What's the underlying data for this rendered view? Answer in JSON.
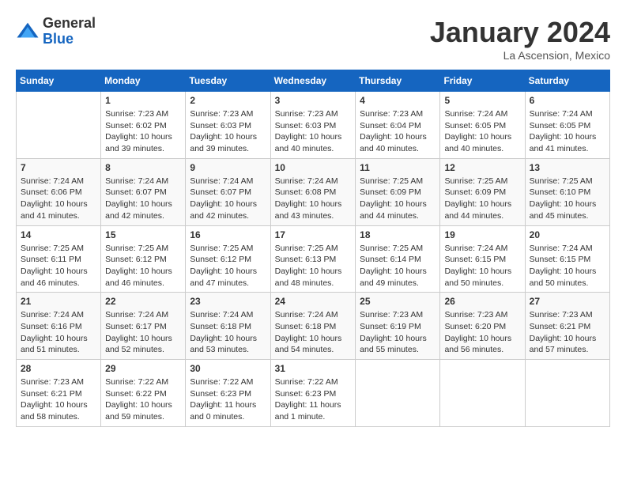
{
  "header": {
    "logo": {
      "general": "General",
      "blue": "Blue"
    },
    "title": "January 2024",
    "location": "La Ascension, Mexico"
  },
  "calendar": {
    "weekdays": [
      "Sunday",
      "Monday",
      "Tuesday",
      "Wednesday",
      "Thursday",
      "Friday",
      "Saturday"
    ],
    "weeks": [
      [
        {
          "day": "",
          "info": ""
        },
        {
          "day": "1",
          "info": "Sunrise: 7:23 AM\nSunset: 6:02 PM\nDaylight: 10 hours\nand 39 minutes."
        },
        {
          "day": "2",
          "info": "Sunrise: 7:23 AM\nSunset: 6:03 PM\nDaylight: 10 hours\nand 39 minutes."
        },
        {
          "day": "3",
          "info": "Sunrise: 7:23 AM\nSunset: 6:03 PM\nDaylight: 10 hours\nand 40 minutes."
        },
        {
          "day": "4",
          "info": "Sunrise: 7:23 AM\nSunset: 6:04 PM\nDaylight: 10 hours\nand 40 minutes."
        },
        {
          "day": "5",
          "info": "Sunrise: 7:24 AM\nSunset: 6:05 PM\nDaylight: 10 hours\nand 40 minutes."
        },
        {
          "day": "6",
          "info": "Sunrise: 7:24 AM\nSunset: 6:05 PM\nDaylight: 10 hours\nand 41 minutes."
        }
      ],
      [
        {
          "day": "7",
          "info": "Sunrise: 7:24 AM\nSunset: 6:06 PM\nDaylight: 10 hours\nand 41 minutes."
        },
        {
          "day": "8",
          "info": "Sunrise: 7:24 AM\nSunset: 6:07 PM\nDaylight: 10 hours\nand 42 minutes."
        },
        {
          "day": "9",
          "info": "Sunrise: 7:24 AM\nSunset: 6:07 PM\nDaylight: 10 hours\nand 42 minutes."
        },
        {
          "day": "10",
          "info": "Sunrise: 7:24 AM\nSunset: 6:08 PM\nDaylight: 10 hours\nand 43 minutes."
        },
        {
          "day": "11",
          "info": "Sunrise: 7:25 AM\nSunset: 6:09 PM\nDaylight: 10 hours\nand 44 minutes."
        },
        {
          "day": "12",
          "info": "Sunrise: 7:25 AM\nSunset: 6:09 PM\nDaylight: 10 hours\nand 44 minutes."
        },
        {
          "day": "13",
          "info": "Sunrise: 7:25 AM\nSunset: 6:10 PM\nDaylight: 10 hours\nand 45 minutes."
        }
      ],
      [
        {
          "day": "14",
          "info": "Sunrise: 7:25 AM\nSunset: 6:11 PM\nDaylight: 10 hours\nand 46 minutes."
        },
        {
          "day": "15",
          "info": "Sunrise: 7:25 AM\nSunset: 6:12 PM\nDaylight: 10 hours\nand 46 minutes."
        },
        {
          "day": "16",
          "info": "Sunrise: 7:25 AM\nSunset: 6:12 PM\nDaylight: 10 hours\nand 47 minutes."
        },
        {
          "day": "17",
          "info": "Sunrise: 7:25 AM\nSunset: 6:13 PM\nDaylight: 10 hours\nand 48 minutes."
        },
        {
          "day": "18",
          "info": "Sunrise: 7:25 AM\nSunset: 6:14 PM\nDaylight: 10 hours\nand 49 minutes."
        },
        {
          "day": "19",
          "info": "Sunrise: 7:24 AM\nSunset: 6:15 PM\nDaylight: 10 hours\nand 50 minutes."
        },
        {
          "day": "20",
          "info": "Sunrise: 7:24 AM\nSunset: 6:15 PM\nDaylight: 10 hours\nand 50 minutes."
        }
      ],
      [
        {
          "day": "21",
          "info": "Sunrise: 7:24 AM\nSunset: 6:16 PM\nDaylight: 10 hours\nand 51 minutes."
        },
        {
          "day": "22",
          "info": "Sunrise: 7:24 AM\nSunset: 6:17 PM\nDaylight: 10 hours\nand 52 minutes."
        },
        {
          "day": "23",
          "info": "Sunrise: 7:24 AM\nSunset: 6:18 PM\nDaylight: 10 hours\nand 53 minutes."
        },
        {
          "day": "24",
          "info": "Sunrise: 7:24 AM\nSunset: 6:18 PM\nDaylight: 10 hours\nand 54 minutes."
        },
        {
          "day": "25",
          "info": "Sunrise: 7:23 AM\nSunset: 6:19 PM\nDaylight: 10 hours\nand 55 minutes."
        },
        {
          "day": "26",
          "info": "Sunrise: 7:23 AM\nSunset: 6:20 PM\nDaylight: 10 hours\nand 56 minutes."
        },
        {
          "day": "27",
          "info": "Sunrise: 7:23 AM\nSunset: 6:21 PM\nDaylight: 10 hours\nand 57 minutes."
        }
      ],
      [
        {
          "day": "28",
          "info": "Sunrise: 7:23 AM\nSunset: 6:21 PM\nDaylight: 10 hours\nand 58 minutes."
        },
        {
          "day": "29",
          "info": "Sunrise: 7:22 AM\nSunset: 6:22 PM\nDaylight: 10 hours\nand 59 minutes."
        },
        {
          "day": "30",
          "info": "Sunrise: 7:22 AM\nSunset: 6:23 PM\nDaylight: 11 hours\nand 0 minutes."
        },
        {
          "day": "31",
          "info": "Sunrise: 7:22 AM\nSunset: 6:23 PM\nDaylight: 11 hours\nand 1 minute."
        },
        {
          "day": "",
          "info": ""
        },
        {
          "day": "",
          "info": ""
        },
        {
          "day": "",
          "info": ""
        }
      ]
    ]
  }
}
